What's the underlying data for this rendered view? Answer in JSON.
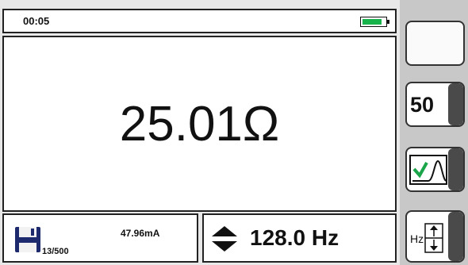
{
  "header": {
    "time": "00:05"
  },
  "main": {
    "reading": "25.01Ω"
  },
  "storage": {
    "count": "13/500",
    "current": "47.96mA"
  },
  "frequency": {
    "value": "128.0 Hz"
  },
  "side_buttons": {
    "range_label": "50"
  },
  "icons": {
    "battery": "battery-icon",
    "save": "floppy-disk-icon",
    "adjust": "up-down-arrows-icon",
    "check": "checkmark-curve-icon",
    "hz": "hz-adjust-icon"
  },
  "colors": {
    "battery_fill": "#18b34a",
    "check": "#1aa54a",
    "knob": "#4a4a4a"
  }
}
